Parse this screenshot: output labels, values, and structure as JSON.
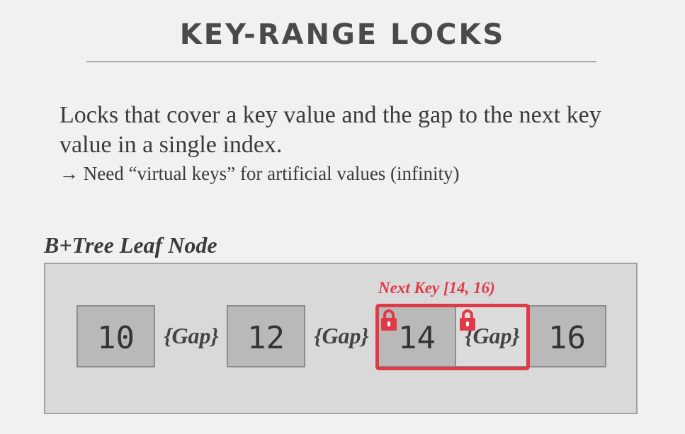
{
  "slide": {
    "title": "KEY-RANGE LOCKS",
    "bullet_main": "Locks that cover a key value and the gap to the next key value in a single index.",
    "bullet_sub": "→ Need “virtual keys” for artificial values (infinity)"
  },
  "diagram": {
    "node_label": "B+Tree Leaf Node",
    "keys": [
      "10",
      "12",
      "14",
      "16"
    ],
    "gap_label": "{Gap}",
    "next_key_label": "Next Key [14, 16)",
    "highlight_color": "#e03a48",
    "key_fill": "#b9b9b9",
    "gap_fill": "#dcdcdc",
    "icons": [
      "lock-icon",
      "lock-icon"
    ]
  }
}
